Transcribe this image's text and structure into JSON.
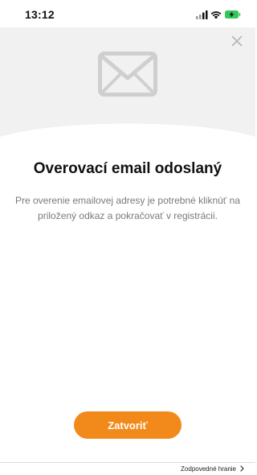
{
  "status_bar": {
    "time": "13:12",
    "icons": [
      "cellular-signal-icon",
      "wifi-icon",
      "battery-charging-icon"
    ],
    "battery_color": "#34c759"
  },
  "modal": {
    "icon": "envelope-icon",
    "close_icon": "close-icon",
    "title": "Overovací email odoslaný",
    "message": "Pre overenie emailovej adresy je potrebné kliknúť na priložený odkaz a pokračovať v registrácii.",
    "close_button_label": "Zatvoriť"
  },
  "footer": {
    "link_label": "Zodpovedné hranie",
    "link_icon": "chevron-right-icon"
  },
  "colors": {
    "accent": "#f28a1b",
    "hero_background": "#f1f1f1",
    "text_muted": "#7a7a7a"
  }
}
